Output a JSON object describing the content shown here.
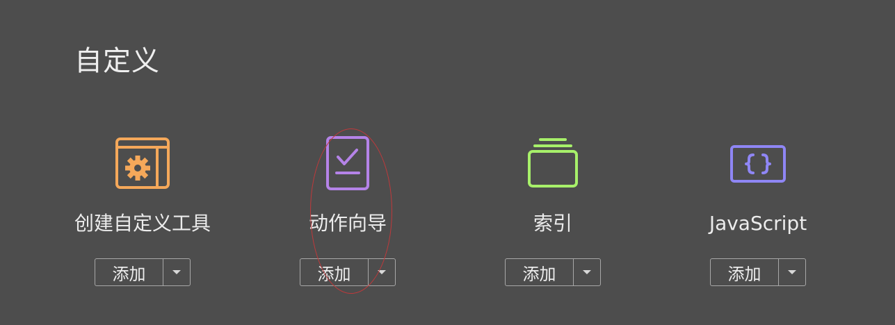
{
  "section": {
    "title": "自定义"
  },
  "tools": [
    {
      "name": "创建自定义工具",
      "icon": "gear-window-icon",
      "color": "#f5a85a",
      "add_label": "添加"
    },
    {
      "name": "动作向导",
      "icon": "checklist-document-icon",
      "color": "#b583e8",
      "add_label": "添加"
    },
    {
      "name": "索引",
      "icon": "stack-folder-icon",
      "color": "#a7f06a",
      "add_label": "添加"
    },
    {
      "name": "JavaScript",
      "icon": "braces-code-icon",
      "color": "#8f86f5",
      "add_label": "添加"
    }
  ]
}
